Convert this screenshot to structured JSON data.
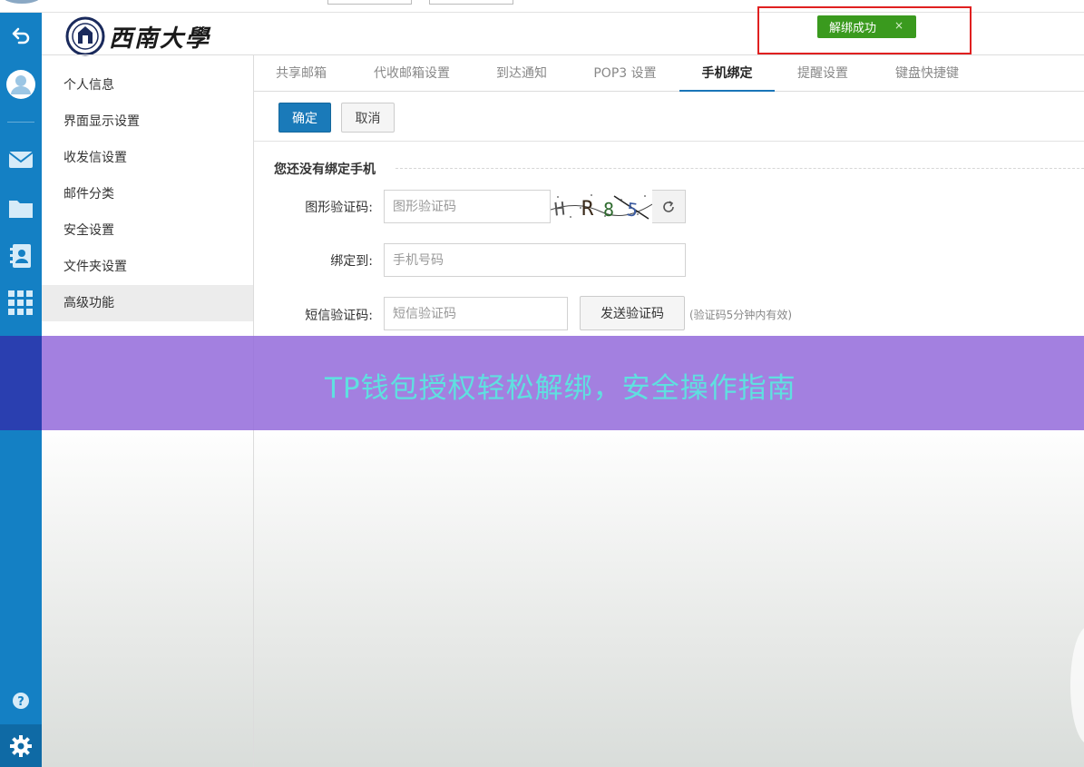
{
  "app": {
    "logo_text": "西南大學"
  },
  "toast": {
    "message": "解绑成功",
    "close_label": "×",
    "color": "#3a9a1e"
  },
  "rail": {
    "items": [
      {
        "name": "back-icon"
      },
      {
        "name": "user-avatar-icon"
      },
      {
        "name": "mail-icon"
      },
      {
        "name": "folder-icon"
      },
      {
        "name": "contacts-icon"
      },
      {
        "name": "apps-grid-icon"
      },
      {
        "name": "help-icon"
      },
      {
        "name": "settings-gear-icon"
      }
    ],
    "color": "#1480c4"
  },
  "side_menu": {
    "items": [
      {
        "label": "个人信息"
      },
      {
        "label": "界面显示设置"
      },
      {
        "label": "收发信设置"
      },
      {
        "label": "邮件分类"
      },
      {
        "label": "安全设置"
      },
      {
        "label": "文件夹设置"
      },
      {
        "label": "高级功能",
        "active": true
      }
    ]
  },
  "tabs": [
    {
      "label": "共享邮箱"
    },
    {
      "label": "代收邮箱设置"
    },
    {
      "label": "到达通知"
    },
    {
      "label": "POP3 设置"
    },
    {
      "label": "手机绑定",
      "active": true
    },
    {
      "label": "提醒设置"
    },
    {
      "label": "键盘快捷键"
    }
  ],
  "toolbar": {
    "confirm_label": "确定",
    "cancel_label": "取消"
  },
  "form": {
    "section_title": "您还没有绑定手机",
    "captcha": {
      "label": "图形验证码:",
      "placeholder": "图形验证码",
      "image_text": "HR85"
    },
    "phone": {
      "label": "绑定到:",
      "placeholder": "手机号码"
    },
    "sms": {
      "label": "短信验证码:",
      "placeholder": "短信验证码",
      "send_label": "发送验证码",
      "hint": "(验证码5分钟内有效)"
    }
  },
  "banner": {
    "text": "TP钱包授权轻松解绑，安全操作指南"
  }
}
